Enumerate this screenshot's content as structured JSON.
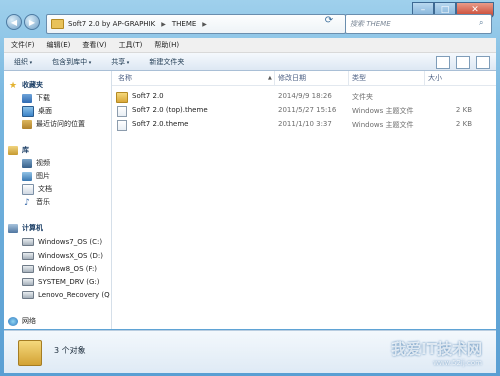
{
  "address": {
    "crumbs": [
      "Soft7 2.0 by AP-GRAPHIK",
      "THEME"
    ],
    "search_placeholder": "搜索 THEME"
  },
  "menu": [
    "文件(F)",
    "编辑(E)",
    "查看(V)",
    "工具(T)",
    "帮助(H)"
  ],
  "toolbar": [
    "组织",
    "包含到库中",
    "共享",
    "新建文件夹"
  ],
  "nav": {
    "favorites": {
      "label": "收藏夹",
      "items": [
        "下载",
        "桌面",
        "最近访问的位置"
      ]
    },
    "libraries": {
      "label": "库",
      "items": [
        "视频",
        "图片",
        "文档",
        "音乐"
      ]
    },
    "computer": {
      "label": "计算机",
      "items": [
        "Windows7_OS (C:)",
        "WindowsX_OS (D:)",
        "Window8_OS (F:)",
        "SYSTEM_DRV (G:)",
        "Lenovo_Recovery (Q"
      ]
    },
    "network": {
      "label": "网络"
    }
  },
  "columns": {
    "name": "名称",
    "date": "修改日期",
    "type": "类型",
    "size": "大小"
  },
  "files": [
    {
      "name": "Soft7 2.0",
      "date": "2014/9/9 18:26",
      "type": "文件夹",
      "size": "",
      "icon": "folder-icon"
    },
    {
      "name": "Soft7 2.0 (top).theme",
      "date": "2011/5/27 15:16",
      "type": "Windows 主题文件",
      "size": "2 KB",
      "icon": "file-icon"
    },
    {
      "name": "Soft7 2.0.theme",
      "date": "2011/1/10 3:37",
      "type": "Windows 主题文件",
      "size": "2 KB",
      "icon": "file-icon"
    }
  ],
  "status": {
    "count": "3 个对象"
  },
  "watermark": {
    "text": "我爱IT技术网",
    "url": "www.52ij.com"
  }
}
